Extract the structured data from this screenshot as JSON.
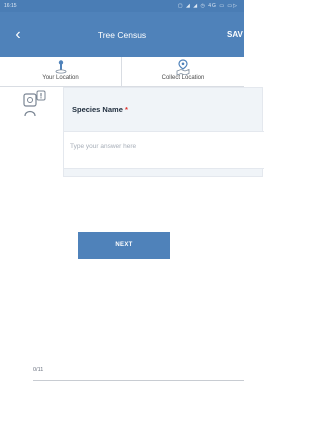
{
  "status_bar": {
    "time": "16:15",
    "icons_text": "▢ ◢ ◢ ◷ 4G ▭ ▭▷"
  },
  "app_bar": {
    "back_icon": "chevron-left-icon",
    "title": "Tree Census",
    "save_label": "SAV"
  },
  "location_bar": {
    "your_location_label": "Your Location",
    "your_location_icon": "location-pin-icon",
    "collect_location_label": "Collect Location",
    "collect_location_icon": "map-marker-icon"
  },
  "question": {
    "icon": "question-info-icon",
    "label": "Species Name",
    "required_mark": "*",
    "answer_placeholder": "Type your answer here"
  },
  "next_button": {
    "label": "NEXT"
  },
  "progress": {
    "text": "0/11",
    "fraction": 0
  },
  "colors": {
    "primary": "#4f82ba",
    "required": "#e0312b"
  }
}
